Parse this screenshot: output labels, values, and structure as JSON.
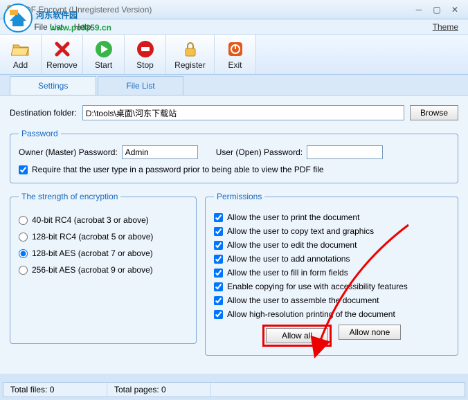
{
  "window": {
    "title": "PDF Encrypt (Unregistered Version)"
  },
  "watermark": {
    "text1": "河东软件园",
    "url": "www.pc0359.cn"
  },
  "menu": {
    "file": "File",
    "filelist": "File List",
    "help": "Help",
    "theme": "Theme"
  },
  "toolbar": {
    "add": "Add",
    "remove": "Remove",
    "start": "Start",
    "stop": "Stop",
    "register": "Register",
    "exit": "Exit"
  },
  "tabs": {
    "settings": "Settings",
    "filelist": "File List"
  },
  "dest": {
    "label": "Destination folder:",
    "value": "D:\\tools\\桌面\\河东下载站",
    "browse": "Browse"
  },
  "password": {
    "legend": "Password",
    "owner_label": "Owner (Master) Password:",
    "owner_value": "Admin",
    "user_label": "User (Open) Password:",
    "user_value": "",
    "require": "Require that the user type in a password prior to being able to view the PDF file"
  },
  "encryption": {
    "legend": "The strength of encryption",
    "o40": "40-bit RC4 (acrobat 3 or above)",
    "o128rc4": "128-bit RC4 (acrobat 5 or above)",
    "o128aes": "128-bit AES (acrobat 7 or above)",
    "o256": "256-bit AES (acrobat 9 or above)"
  },
  "permissions": {
    "legend": "Permissions",
    "p1": "Allow the user to print the document",
    "p2": "Allow the user to copy text and graphics",
    "p3": "Allow the user to edit the document",
    "p4": "Allow the user to add annotations",
    "p5": "Allow the user to fill in form fields",
    "p6": "Enable copying for use with accessibility features",
    "p7": "Allow the user to assemble the document",
    "p8": "Allow high-resolution printing of the document",
    "allow_all": "Allow all",
    "allow_none": "Allow none"
  },
  "status": {
    "files": "Total files: 0",
    "pages": "Total pages: 0"
  }
}
